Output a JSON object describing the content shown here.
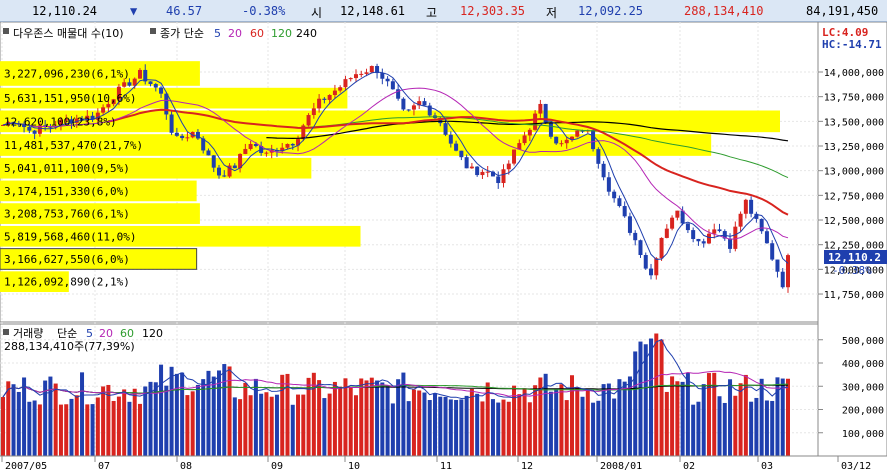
{
  "quote": {
    "price": "12,110.24",
    "change_arrow": "▼",
    "change": "46.57",
    "change_pct": "-0.38%",
    "open_label": "시",
    "open": "12,148.61",
    "high_label": "고",
    "high": "12,303.35",
    "low_label": "저",
    "low": "12,092.25",
    "volume": "288,134,410",
    "amount": "84,191,450"
  },
  "price_panel": {
    "title": "다우존스 매물대 수(10)",
    "ma_label": "종가 단순",
    "ma_periods": [
      "5",
      "20",
      "60",
      "120",
      "240"
    ],
    "ma_colors": [
      "#1f3fae",
      "#b526b5",
      "#d8241f",
      "#2e9c2e",
      "#000000"
    ],
    "lc_label": "LC:4.09",
    "hc_label": "HC:-14.71",
    "last_price_label": "12,110.2",
    "last_change_label": "-0.38%",
    "y_axis_ticks": [
      "14,000,000",
      "13,750,000",
      "13,500,000",
      "13,250,000",
      "13,000,000",
      "12,750,000",
      "12,500,000",
      "12,250,000",
      "12,000,000",
      "11,750,000"
    ],
    "volume_profile": [
      {
        "label": "3,227,096,230(6,1%)",
        "pct": 6.1,
        "price_from": 13850,
        "price_to": 14120
      },
      {
        "label": "5,631,151,950(10,6%)",
        "pct": 10.6,
        "price_from": 13620,
        "price_to": 13850
      },
      {
        "label": "12,620,100(23,8%)",
        "pct": 23.8,
        "price_from": 13380,
        "price_to": 13620
      },
      {
        "label": "11,481,537,470(21,7%)",
        "pct": 21.7,
        "price_from": 13140,
        "price_to": 13380
      },
      {
        "label": "5,041,011,100(9,5%)",
        "pct": 9.5,
        "price_from": 12910,
        "price_to": 13140
      },
      {
        "label": "3,174,151,330(6,0%)",
        "pct": 6.0,
        "price_from": 12680,
        "price_to": 12910
      },
      {
        "label": "3,208,753,760(6,1%)",
        "pct": 6.1,
        "price_from": 12450,
        "price_to": 12680
      },
      {
        "label": "5,819,568,460(11,0%)",
        "pct": 11.0,
        "price_from": 12220,
        "price_to": 12450
      },
      {
        "label": "3,166,627,550(6,0%)",
        "pct": 6.0,
        "price_from": 11990,
        "price_to": 12220
      },
      {
        "label": "1,126,092,890(2,1%)",
        "pct": 2.1,
        "price_from": 11760,
        "price_to": 11990
      }
    ]
  },
  "volume_panel": {
    "title": "거래량",
    "ma_label": "단순",
    "ma_periods": [
      "5",
      "20",
      "60",
      "120"
    ],
    "info_label": "288,134,410주(77,39%)",
    "y_axis_ticks": [
      "500,000",
      "400,000",
      "300,000",
      "200,000",
      "100,000"
    ]
  },
  "x_axis_labels": [
    "2007/05",
    "07",
    "08",
    "09",
    "10",
    "11",
    "12",
    "2008/01",
    "02",
    "03",
    "03/12"
  ],
  "colors": {
    "up": "#d8241f",
    "down": "#1f3fae",
    "highlight": "#ffff00",
    "grid": "#e6e6e6"
  }
}
